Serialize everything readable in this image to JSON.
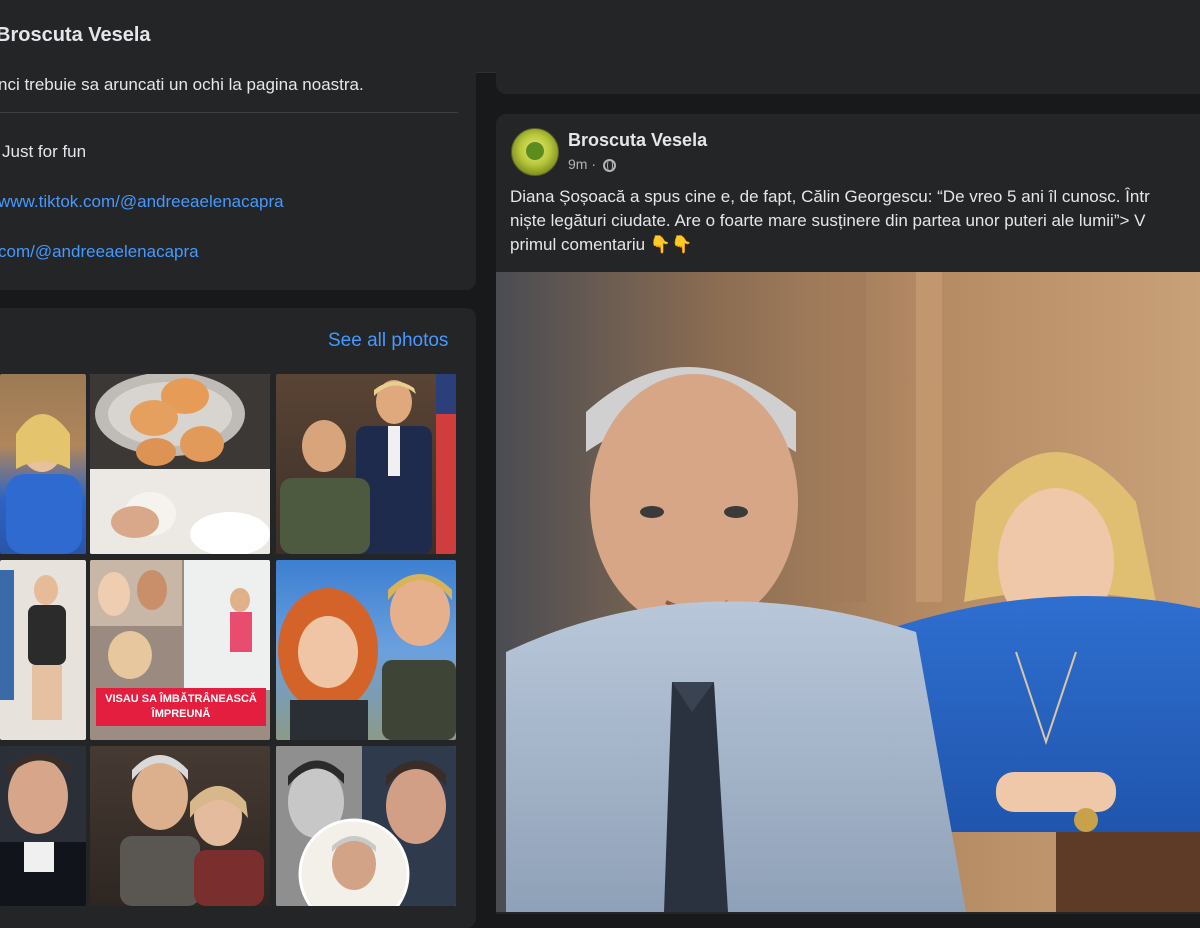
{
  "header": {
    "page_name": "Broscuta Vesela"
  },
  "intro": {
    "text": "nci trebuie sa aruncati un ochi la pagina noastra.",
    "category": "Just for fun",
    "links": [
      "www.tiktok.com/@andreeaelenacapra",
      "com/@andreeaelenacapra"
    ]
  },
  "photos": {
    "see_all_label": "See all photos",
    "overlay_caption": "VISAU SA ÎMBĂTRÂNEASCĂ\nÎMPREUNĂ"
  },
  "post": {
    "author": "Broscuta Vesela",
    "time": "9m",
    "separator": "·",
    "text": "Diana Șoșoacă a spus cine e, de fapt, Călin Georgescu: “De vreo 5 ani îl cunosc. Într\nniște legături ciudate. Are o foarte mare susținere din partea unor puteri ale lumii”> V\nprimul comentariu 👇👇",
    "visibility_icon": "globe-icon"
  },
  "colors": {
    "background": "#18191a",
    "card": "#242526",
    "link": "#4599ff",
    "text_primary": "#e4e6eb",
    "text_secondary": "#b0b3b8",
    "caption_banner": "#e41e3f"
  }
}
